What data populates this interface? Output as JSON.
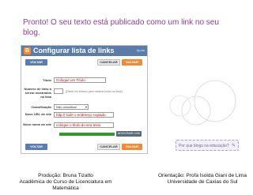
{
  "slide": {
    "heading": "Pronto! O seu texto está publicado como um link no seu blog."
  },
  "screenshot": {
    "logo_letter": "B",
    "title": "Configurar lista de links",
    "help_link": "Ajuda",
    "buttons": {
      "back": "VOLTAR",
      "cancel": "CANCELAR",
      "save": "SALVAR",
      "add_link": "ADICIONAR LINK"
    },
    "form": {
      "title_label": "Título",
      "title_value": "Coloque um Título",
      "count_label": "Número de links a serem mostrados na lista",
      "count_hint": "(Deixe em branco para mostrar todos os links)",
      "sort_label": "Classificação",
      "sort_value": "Não classificar",
      "url_label": "Novo URL do site",
      "url_value": "http:// Cole o endereço copiado",
      "name_label": "Novo nome do site",
      "name_value": "coloque o título do seu texto"
    }
  },
  "side_box": {
    "text": "Por que blogs na educação?",
    "icon": "pencil-icon"
  },
  "credits": {
    "left_line1": "Produção: Bruna Tizatto",
    "left_line2": "Acadêmica do Curso de Licenciatura em Matemática",
    "right_line1": "Orientação: Profa Isolda Giani de Lima",
    "right_line2": "Universidade de Caxias do Sul"
  },
  "colors": {
    "heading": "#8e3e94",
    "title_bar": "#5b7ba8",
    "save_button": "#f18a34",
    "field_text": "#d10000",
    "green_bar": "#2e9a2e"
  }
}
